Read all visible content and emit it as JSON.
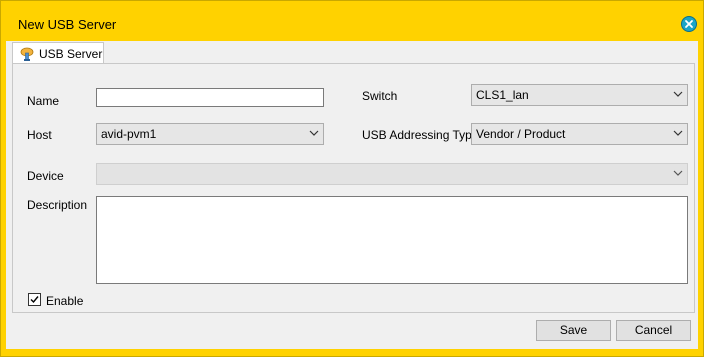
{
  "window": {
    "title": "New USB Server"
  },
  "tabs": [
    {
      "label": "USB Server"
    }
  ],
  "form": {
    "name_label": "Name",
    "name_value": "",
    "switch_label": "Switch",
    "switch_value": "CLS1_lan",
    "host_label": "Host",
    "host_value": "avid-pvm1",
    "addressing_label": "USB Addressing Type",
    "addressing_value": "Vendor / Product",
    "device_label": "Device",
    "device_value": "",
    "description_label": "Description",
    "description_value": "",
    "enable_label": "Enable",
    "enable_checked": true
  },
  "buttons": {
    "save": "Save",
    "cancel": "Cancel"
  },
  "colors": {
    "title_bar": "#ffd200",
    "close_button": "#1aa5c6"
  },
  "icons": {
    "tab": "usb-server-icon",
    "close": "close-icon",
    "dropdown": "chevron-down-icon",
    "check": "check-icon"
  }
}
